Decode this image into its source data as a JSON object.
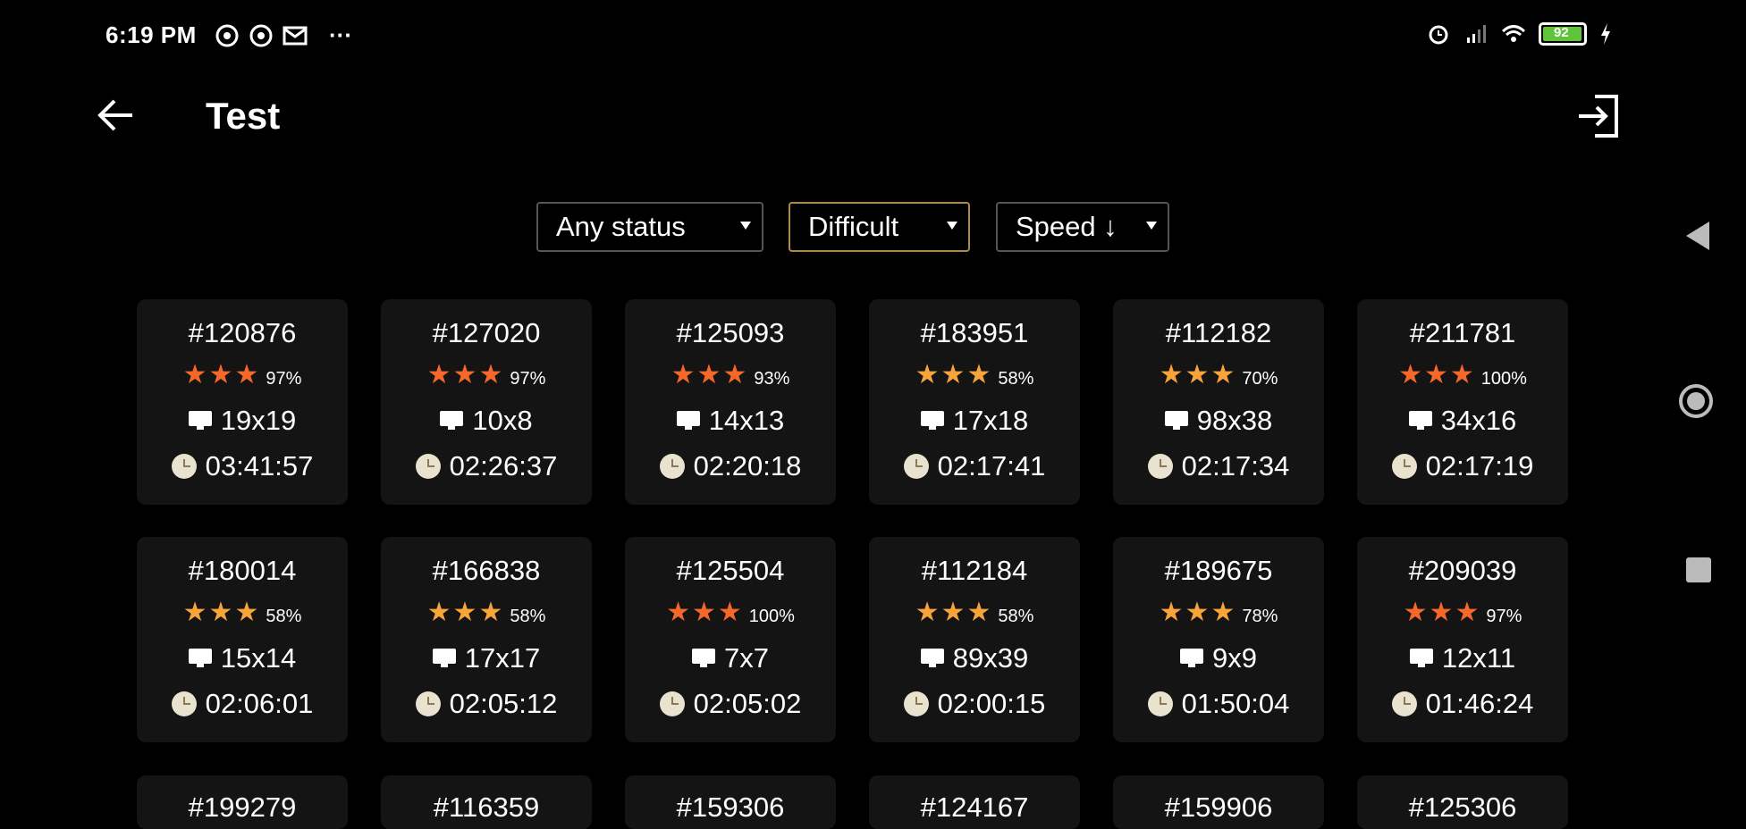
{
  "status_bar": {
    "time": "6:19 PM",
    "more": "···",
    "battery": "92",
    "left_icons": [
      "whatsapp-icon",
      "whatsapp-icon",
      "mail-icon"
    ],
    "right_icons": [
      "alarm-icon",
      "signal-icon",
      "wifi-icon",
      "battery-icon",
      "charging-icon"
    ]
  },
  "app_bar": {
    "title": "Test"
  },
  "filters": {
    "status": "Any status",
    "difficulty": "Difficult",
    "sort": "Speed ↓"
  },
  "colors": {
    "star_orange": "#f5682a",
    "star_amber": "#f7a43b",
    "selected_border": "#b08a4a",
    "card_bg": "#141414"
  },
  "puzzles": [
    {
      "id": "#120876",
      "percent": "97%",
      "star_color": "#f5682a",
      "size": "19x19",
      "time": "03:41:57"
    },
    {
      "id": "#127020",
      "percent": "97%",
      "star_color": "#f5682a",
      "size": "10x8",
      "time": "02:26:37"
    },
    {
      "id": "#125093",
      "percent": "93%",
      "star_color": "#f5682a",
      "size": "14x13",
      "time": "02:20:18"
    },
    {
      "id": "#183951",
      "percent": "58%",
      "star_color": "#f7a43b",
      "size": "17x18",
      "time": "02:17:41"
    },
    {
      "id": "#112182",
      "percent": "70%",
      "star_color": "#f7a43b",
      "size": "98x38",
      "time": "02:17:34"
    },
    {
      "id": "#211781",
      "percent": "100%",
      "star_color": "#f5682a",
      "size": "34x16",
      "time": "02:17:19"
    },
    {
      "id": "#180014",
      "percent": "58%",
      "star_color": "#f7a43b",
      "size": "15x14",
      "time": "02:06:01"
    },
    {
      "id": "#166838",
      "percent": "58%",
      "star_color": "#f7a43b",
      "size": "17x17",
      "time": "02:05:12"
    },
    {
      "id": "#125504",
      "percent": "100%",
      "star_color": "#f5682a",
      "size": "7x7",
      "time": "02:05:02"
    },
    {
      "id": "#112184",
      "percent": "58%",
      "star_color": "#f7a43b",
      "size": "89x39",
      "time": "02:00:15"
    },
    {
      "id": "#189675",
      "percent": "78%",
      "star_color": "#f7a43b",
      "size": "9x9",
      "time": "01:50:04"
    },
    {
      "id": "#209039",
      "percent": "97%",
      "star_color": "#f5682a",
      "size": "12x11",
      "time": "01:46:24"
    }
  ],
  "partial_row_ids": [
    "#199279",
    "#116359",
    "#159306",
    "#124167",
    "#159906",
    "#125306"
  ]
}
